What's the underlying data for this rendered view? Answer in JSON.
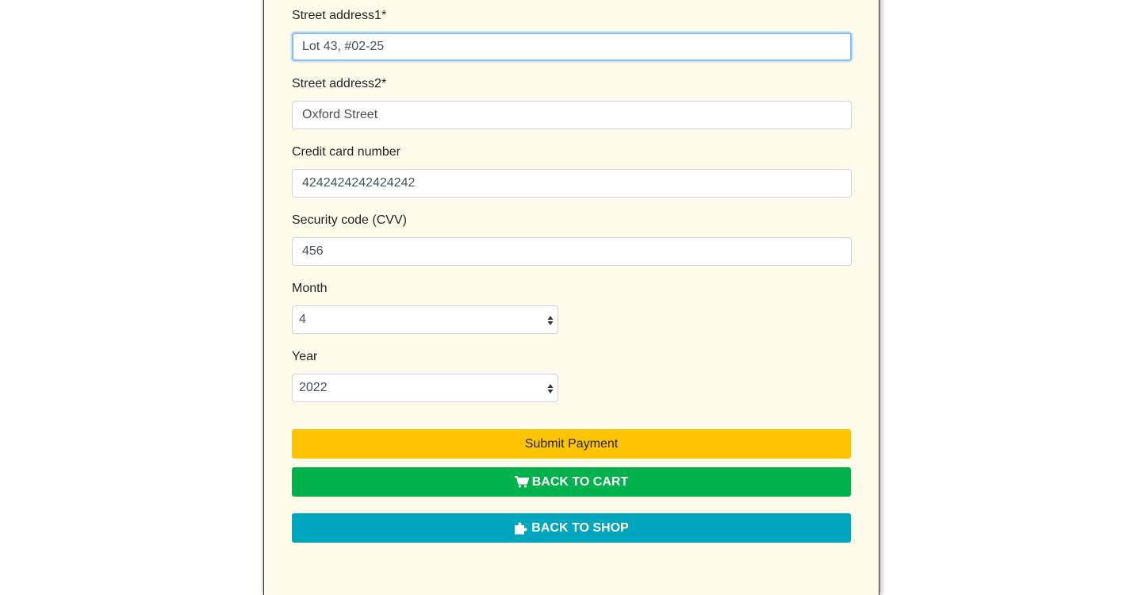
{
  "form": {
    "street1": {
      "label": "Street address1*",
      "value": "Lot 43, #02-25"
    },
    "street2": {
      "label": "Street address2*",
      "value": "Oxford Street"
    },
    "card": {
      "label": "Credit card number",
      "value": "4242424242424242"
    },
    "cvv": {
      "label": "Security code (CVV)",
      "value": "456"
    },
    "month": {
      "label": "Month",
      "selected": "4"
    },
    "year": {
      "label": "Year",
      "selected": "2022"
    }
  },
  "buttons": {
    "submit_label": "Submit Payment",
    "back_to_cart_label": "BACK TO CART",
    "back_to_shop_label": "BACK TO SHOP"
  },
  "icons": {
    "cart": "shopping-cart-icon",
    "shop": "puzzle-piece-icon"
  },
  "colors": {
    "panel_bg": "#fffbea",
    "submit": "#ffc401",
    "back_to_cart": "#00b14c",
    "back_to_shop": "#00a6bd",
    "focus_border": "#80bdff"
  }
}
